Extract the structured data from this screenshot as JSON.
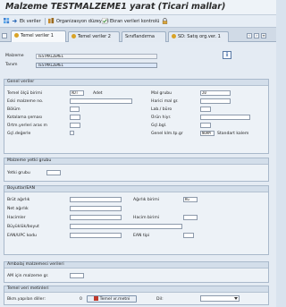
{
  "title": "Malzeme TESTMALZEME1 yarat (Ticari mallar)",
  "toolbar": {
    "ek_veriler": "Ek veriler",
    "organizasyon": "Organizasyon düzeyleri",
    "ekran_verileri": "Ekran verileri kontrolü"
  },
  "tabs": [
    "Temel veriler 1",
    "Temel veriler 2",
    "Sınıflandırma",
    "SD: Satış org.ver. 1"
  ],
  "header_fields": {
    "malzeme_label": "Malzeme",
    "malzeme_value": "TESTMALZEME1",
    "tanim_label": "Tanım",
    "tanim_value": "TESTMALZEME1"
  },
  "genel": {
    "header": "Genel veriler",
    "temel_olcu_label": "Temel ölçü birimi",
    "temel_olcu_value": "ADT",
    "temel_olcu_text": "Adet",
    "mal_grubu_label": "Mal grubu",
    "mal_grubu_value": "20",
    "eski_malzeme_label": "Eski malzeme no.",
    "harici_label": "Harici mal gr.",
    "bolum_label": "Bölüm",
    "lab_label": "Lab./ büro",
    "kotalama_label": "Kotalama şeması",
    "urun_hiyr_label": "Ürün hiyr.",
    "urtm_label": "Ürtm.yerleri aras m",
    "gcl_bgl_label": "Gçl.bgl.",
    "gcl_deg_label": "Gçl.değerle",
    "genel_kalem_label": "Genel klm.tp.gr",
    "genel_kalem_value": "NORM",
    "genel_kalem_text": "Standart kalem"
  },
  "yetki": {
    "header": "Malzeme yetki grubu",
    "yetki_label": "Yetki grubu"
  },
  "boyut": {
    "header": "Boyutlar/EAN",
    "brut_label": "Brüt ağırlık",
    "agirlik_birimi_label": "Ağırlık birimi",
    "agirlik_birimi_value": "KG",
    "net_label": "Net ağırlık",
    "hacimler_label": "Hacimler",
    "hacim_birimi_label": "Hacim birimi",
    "buyukluk_label": "Büyüklük/boyut",
    "ean_label": "EAN/UPC kodu",
    "ean_tipi_label": "EAN tipi"
  },
  "ambalaj": {
    "header": "Ambalaj malzemesi verileri",
    "am_label": "AM için malzeme gr."
  },
  "metin": {
    "header": "Temel veri metinleri",
    "bkm_label": "Bkm.yapılan diller:",
    "bkm_value": "0",
    "btn_label": "Temel vr.metni",
    "dil_label": "Dil:"
  }
}
